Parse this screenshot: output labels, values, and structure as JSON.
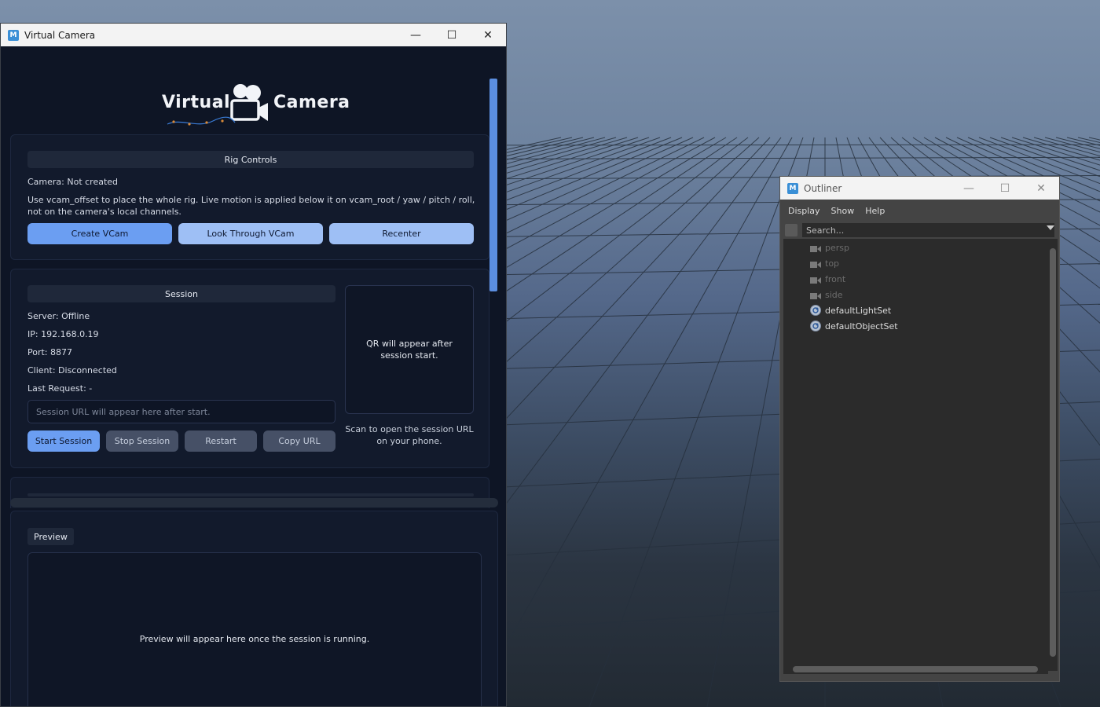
{
  "vc_window": {
    "title": "Virtual Camera",
    "logo": {
      "word1": "Virtual",
      "word2": "Camera"
    },
    "rig_controls": {
      "header": "Rig Controls",
      "camera_status": "Camera: Not created",
      "description": "Use vcam_offset to place the whole rig. Live motion is applied below it on vcam_root / yaw / pitch / roll, not on the camera's local channels.",
      "buttons": [
        "Create VCam",
        "Look Through VCam",
        "Recenter"
      ]
    },
    "session": {
      "header": "Session",
      "server": "Server: Offline",
      "ip": "IP: 192.168.0.19",
      "port": "Port: 8877",
      "client": "Client: Disconnected",
      "last_request": "Last Request: -",
      "url_placeholder": "Session URL will appear here after start.",
      "buttons": [
        "Start Session",
        "Stop Session",
        "Restart",
        "Copy URL"
      ],
      "qr_placeholder": "QR will appear after session start.",
      "qr_caption": "Scan to open the session URL on your phone."
    },
    "preview": {
      "tab": "Preview",
      "placeholder": "Preview will appear here once the session is running."
    }
  },
  "outliner": {
    "title": "Outliner",
    "menu": [
      "Display",
      "Show",
      "Help"
    ],
    "search_placeholder": "Search...",
    "items": [
      {
        "label": "persp",
        "icon": "camera-icon",
        "dim": true
      },
      {
        "label": "top",
        "icon": "camera-icon",
        "dim": true
      },
      {
        "label": "front",
        "icon": "camera-icon",
        "dim": true
      },
      {
        "label": "side",
        "icon": "camera-icon",
        "dim": true
      },
      {
        "label": "defaultLightSet",
        "icon": "set-icon",
        "dim": false
      },
      {
        "label": "defaultObjectSet",
        "icon": "set-icon",
        "dim": false
      }
    ]
  },
  "colors": {
    "accent": "#6b9ef2",
    "panel": "#121a2c",
    "window_bg": "#0e1525"
  }
}
